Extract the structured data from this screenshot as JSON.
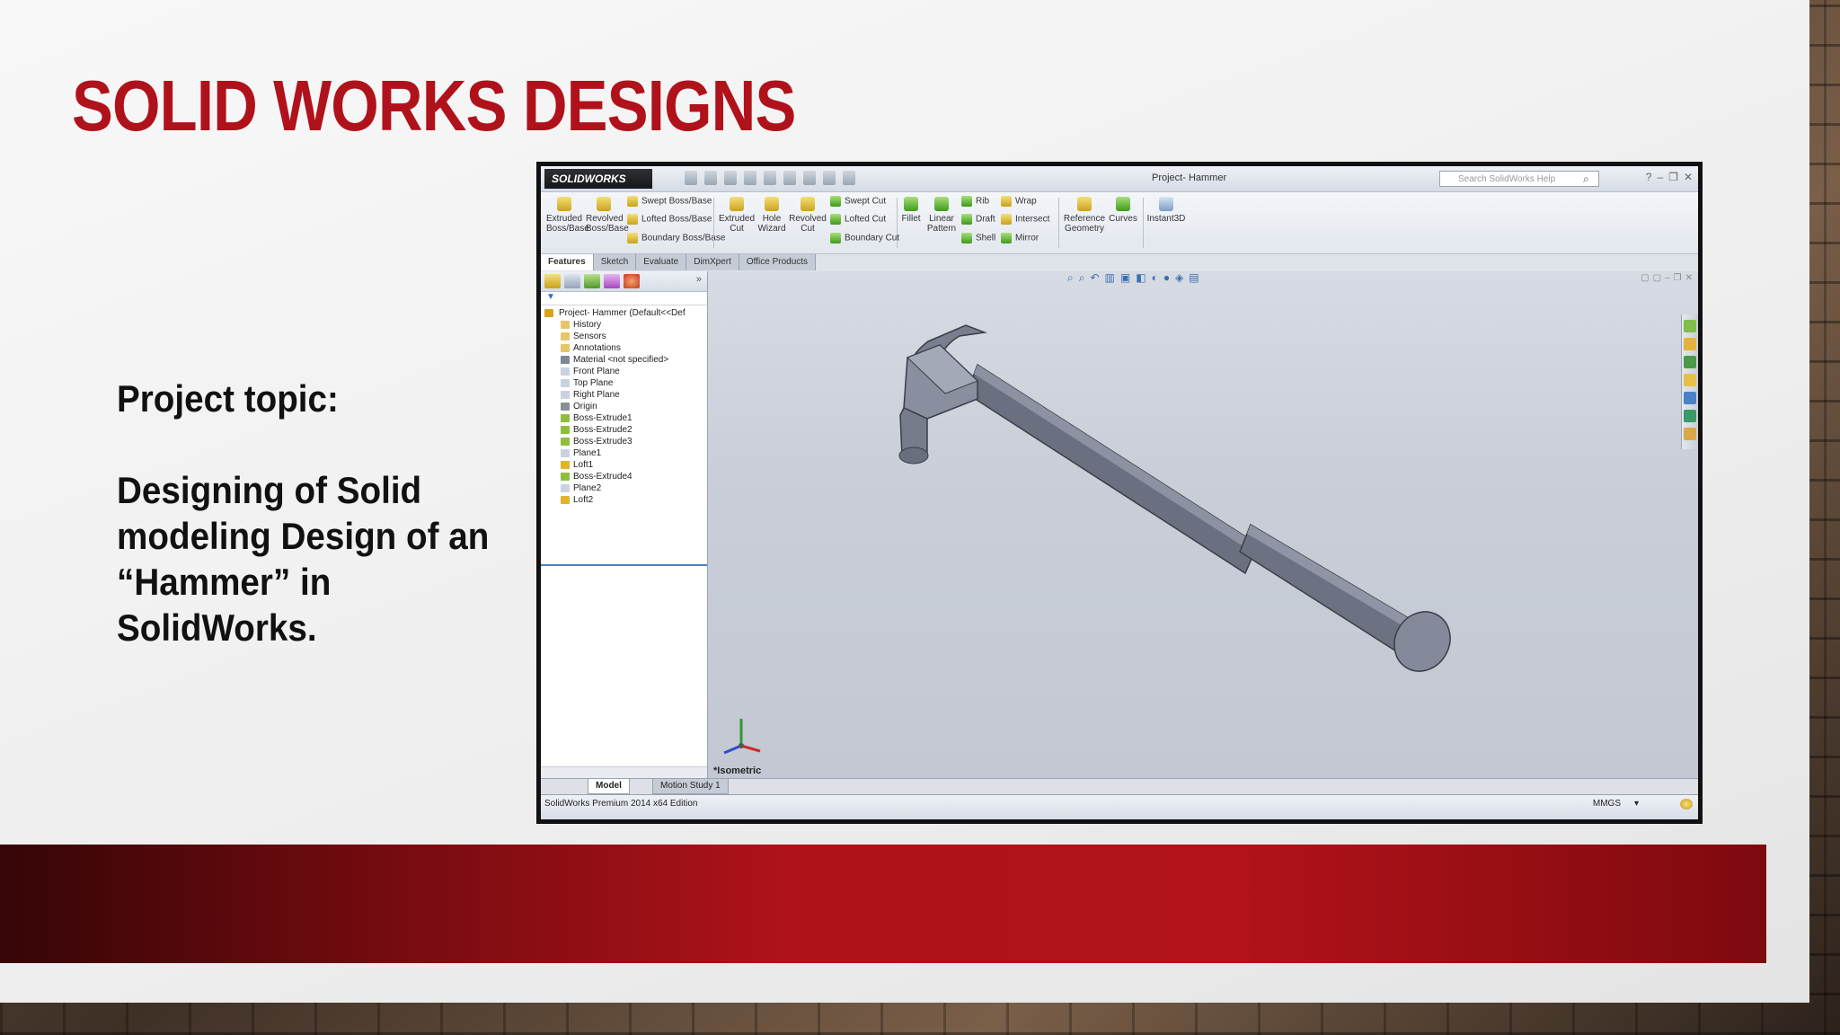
{
  "slide": {
    "title": "SOLID WORKS DESIGNS",
    "topic_label": "Project topic:",
    "topic_text": "Designing of Solid modeling Design of an “Hammer” in SolidWorks."
  },
  "colors": {
    "title_red": "#b0121b",
    "band_red": "#b3121a"
  },
  "solidworks": {
    "logo": "SOLIDWORKS",
    "document_title": "Project- Hammer",
    "help_search_placeholder": "Search SolidWorks Help",
    "commands": {
      "extruded_boss": "Extruded Boss/Base",
      "revolved_boss": "Revolved Boss/Base",
      "swept_boss": "Swept Boss/Base",
      "lofted_boss": "Lofted Boss/Base",
      "boundary_boss": "Boundary Boss/Base",
      "extruded_cut": "Extruded Cut",
      "hole_wizard": "Hole Wizard",
      "revolved_cut": "Revolved Cut",
      "swept_cut": "Swept Cut",
      "lofted_cut": "Lofted Cut",
      "boundary_cut": "Boundary Cut",
      "fillet": "Fillet",
      "linear_pattern": "Linear Pattern",
      "rib": "Rib",
      "draft": "Draft",
      "shell": "Shell",
      "wrap": "Wrap",
      "intersect": "Intersect",
      "mirror": "Mirror",
      "reference_geometry": "Reference Geometry",
      "curves": "Curves",
      "instant3d": "Instant3D"
    },
    "tabs": [
      "Features",
      "Sketch",
      "Evaluate",
      "DimXpert",
      "Office Products"
    ],
    "tree": [
      "Project- Hammer  (Default<<Def",
      "History",
      "Sensors",
      "Annotations",
      "Material <not specified>",
      "Front Plane",
      "Top Plane",
      "Right Plane",
      "Origin",
      "Boss-Extrude1",
      "Boss-Extrude2",
      "Boss-Extrude3",
      "Plane1",
      "Loft1",
      "Boss-Extrude4",
      "Plane2",
      "Loft2"
    ],
    "view_orientation": "*Isometric",
    "bottom_tabs": [
      "Model",
      "Motion Study 1"
    ],
    "status_text": "SolidWorks Premium 2014 x64 Edition",
    "units": "MMGS"
  }
}
